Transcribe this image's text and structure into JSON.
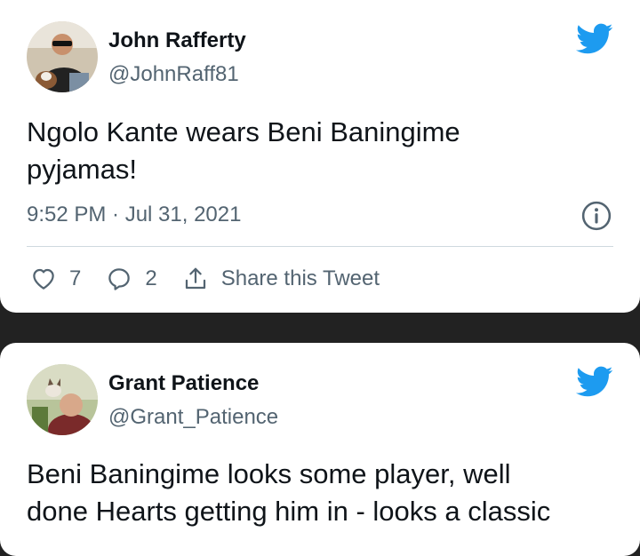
{
  "tweets": [
    {
      "name": "John Rafferty",
      "handle": "@JohnRaff81",
      "text": "Ngolo Kante wears Beni Baningime pyjamas!",
      "timestamp": "9:52 PM · Jul 31, 2021",
      "likes": "7",
      "replies": "2",
      "share_label": "Share this Tweet"
    },
    {
      "name": "Grant Patience",
      "handle": "@Grant_Patience",
      "text_line1": "Beni Baningime looks some player, well",
      "text_line2": "done Hearts getting him in - looks a classic"
    }
  ],
  "colors": {
    "twitter_blue": "#1d9bf0",
    "text_primary": "#0f1419",
    "text_secondary": "#536471",
    "background": "#222222"
  },
  "icons": [
    "twitter-bird-icon",
    "info-icon",
    "heart-icon",
    "reply-icon",
    "share-icon"
  ]
}
